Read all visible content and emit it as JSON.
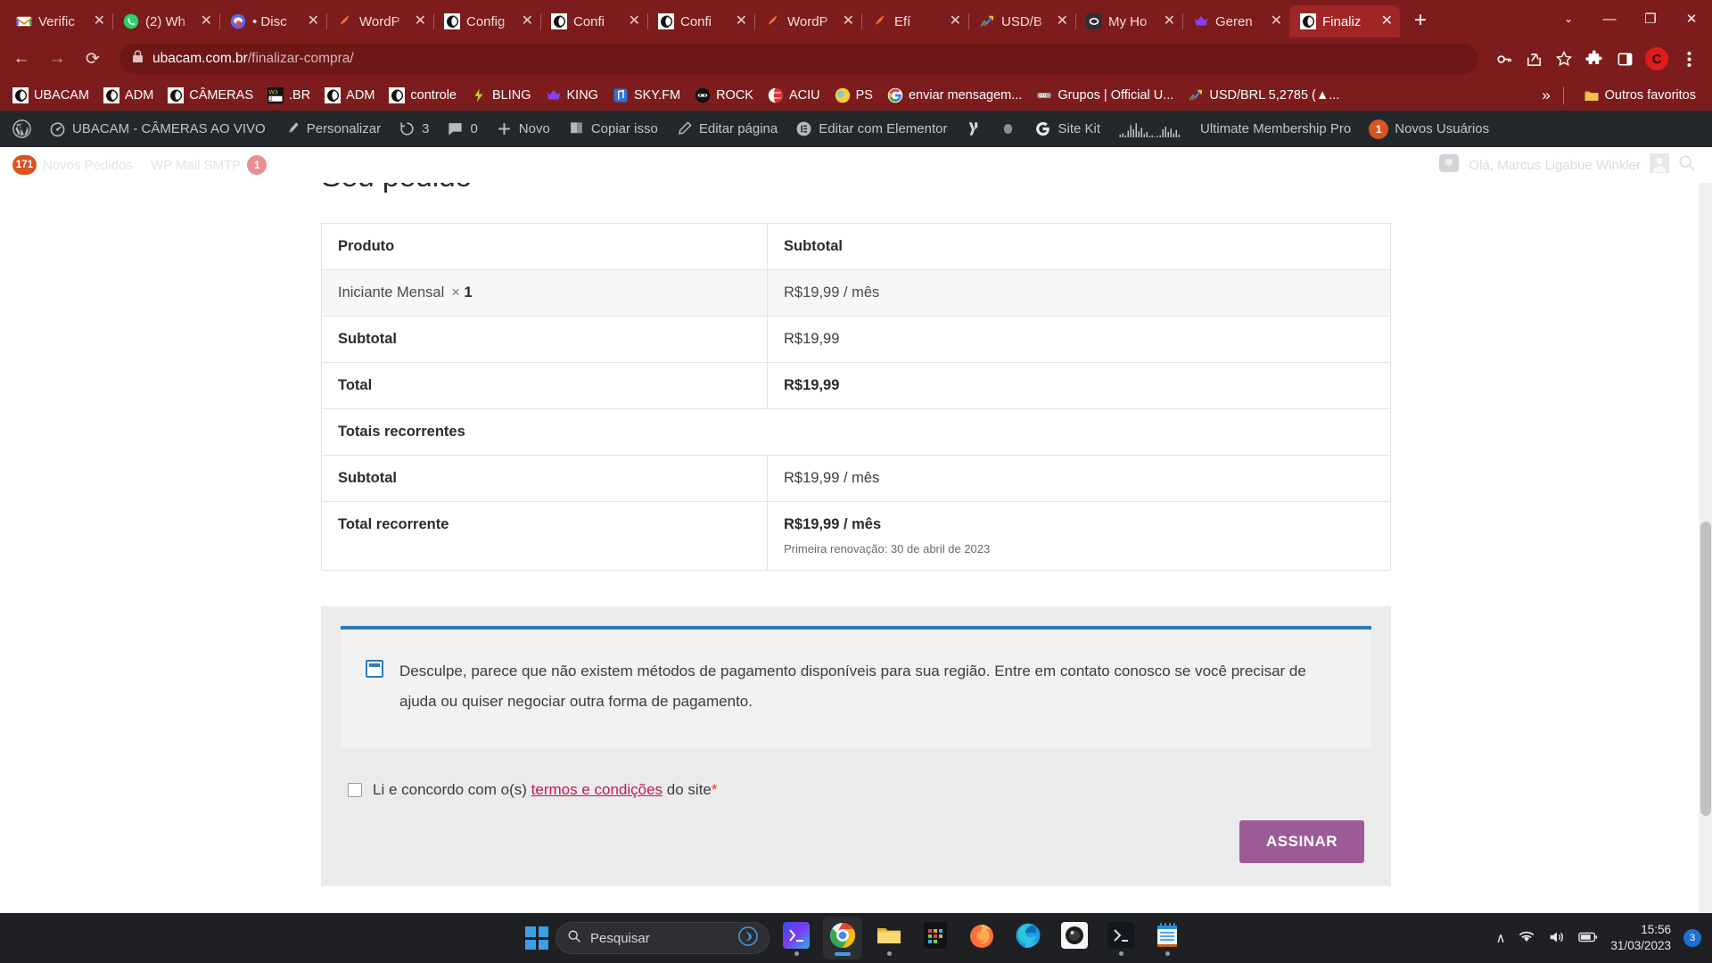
{
  "browser": {
    "tabs": [
      {
        "title": "Verific",
        "icon": "gmail-icon",
        "active": false
      },
      {
        "title": "(2) Wh",
        "icon": "whatsapp-icon",
        "active": false
      },
      {
        "title": "• Disc",
        "icon": "discord-icon",
        "active": false
      },
      {
        "title": "WordP",
        "icon": "elementor-icon",
        "active": false
      },
      {
        "title": "Config",
        "icon": "ubacam-icon",
        "active": false
      },
      {
        "title": "Confi",
        "icon": "ubacam-icon",
        "active": false
      },
      {
        "title": "Confi",
        "icon": "ubacam-icon",
        "active": false
      },
      {
        "title": "WordP",
        "icon": "elementor-icon",
        "active": false
      },
      {
        "title": "Efí",
        "icon": "elementor-icon",
        "active": false
      },
      {
        "title": "USD/B",
        "icon": "google-finance-icon",
        "active": false
      },
      {
        "title": "My Ho",
        "icon": "hostinger-icon",
        "active": false
      },
      {
        "title": "Geren",
        "icon": "crown-icon",
        "active": false
      },
      {
        "title": "Finaliz",
        "icon": "ubacam-icon",
        "active": true
      }
    ],
    "new_tab_label": "+",
    "close_label": "✕",
    "window_controls": {
      "list": "⌄",
      "minimize": "—",
      "maximize": "❐",
      "close": "✕"
    },
    "nav": {
      "back": "←",
      "forward": "→",
      "reload": "⟳"
    },
    "url": {
      "lock": "lock-icon",
      "domain": "ubacam.com.br",
      "path": "/finalizar-compra/"
    },
    "toolbar_icons": [
      "key-icon",
      "share-icon",
      "bookmark-star-icon",
      "extensions-puzzle-icon",
      "side-panel-icon",
      "profile-avatar-icon",
      "chrome-menu-icon"
    ],
    "profile_initial": "C"
  },
  "bookmarks": {
    "items": [
      {
        "label": "UBACAM",
        "icon": "ubacam-icon"
      },
      {
        "label": "ADM",
        "icon": "ubacam-icon"
      },
      {
        "label": "CÂMERAS",
        "icon": "ubacam-icon"
      },
      {
        "label": ".BR",
        "icon": "registrobr-icon"
      },
      {
        "label": "ADM",
        "icon": "ubacam-icon"
      },
      {
        "label": "controle",
        "icon": "ubacam-icon"
      },
      {
        "label": "BLING",
        "icon": "bling-icon"
      },
      {
        "label": "KING",
        "icon": "crown-icon"
      },
      {
        "label": "SKY.FM",
        "icon": "radio-icon"
      },
      {
        "label": "ROCK",
        "icon": "rock-icon"
      },
      {
        "label": "ACIU",
        "icon": "globe-icon"
      },
      {
        "label": "PS",
        "icon": "ps-icon"
      },
      {
        "label": "enviar mensagem...",
        "icon": "google-icon"
      },
      {
        "label": "Grupos | Official U...",
        "icon": "google-docs-icon"
      },
      {
        "label": "USD/BRL 5,2785 (▲...",
        "icon": "google-finance-icon"
      }
    ],
    "overflow_label": "»",
    "other_label": "Outros favoritos",
    "other_icon": "folder-icon"
  },
  "wp_admin_bar": {
    "items": [
      {
        "label": "",
        "icon": "wordpress-logo-icon"
      },
      {
        "label": "UBACAM - CÂMERAS AO VIVO",
        "icon": "dashboard-icon"
      },
      {
        "label": "Personalizar",
        "icon": "brush-icon"
      },
      {
        "label": "3",
        "icon": "updates-icon"
      },
      {
        "label": "0",
        "icon": "comments-icon"
      },
      {
        "label": "Novo",
        "icon": "plus-icon"
      },
      {
        "label": "Copiar isso",
        "icon": "copy-icon"
      },
      {
        "label": "Editar página",
        "icon": "pencil-icon"
      },
      {
        "label": "Editar com Elementor",
        "icon": "elementor-e-icon"
      },
      {
        "label": "",
        "icon": "yoast-icon"
      },
      {
        "label": "",
        "icon": "gray-dot-icon"
      },
      {
        "label": "Site Kit",
        "icon": "google-g-icon"
      },
      {
        "label": "",
        "icon": "analytics-sparkline-icon"
      },
      {
        "label": "Ultimate Membership Pro",
        "icon": ""
      },
      {
        "label": "Novos Usuários",
        "icon": "",
        "badge": "1"
      }
    ],
    "second_row": {
      "orders_badge": "171",
      "orders_label": "Novos Pedidos",
      "smtp_label": "WP Mail SMTP",
      "smtp_badge": "1",
      "greeting": "Olá, Marcus Ligabue Winkler",
      "comment_icon": "comment-bubble-icon",
      "avatar_icon": "user-avatar-icon",
      "search_icon": "search-icon"
    }
  },
  "order": {
    "title": "Seu pedido",
    "headers": [
      "Produto",
      "Subtotal"
    ],
    "rows": [
      {
        "kind": "product",
        "label": "Iniciante Mensal",
        "times": "×",
        "qty": "1",
        "value": "R$19,99 / mês"
      },
      {
        "kind": "normal",
        "label": "Subtotal",
        "value": "R$19,99"
      },
      {
        "kind": "strong",
        "label": "Total",
        "value": "R$19,99"
      },
      {
        "kind": "section",
        "label": "Totais recorrentes",
        "value": ""
      },
      {
        "kind": "normal",
        "label": "Subtotal",
        "value": "R$19,99 / mês"
      },
      {
        "kind": "strong",
        "label": "Total recorrente",
        "value": "R$19,99 / mês",
        "note": "Primeira renovação: 30 de abril de 2023"
      }
    ]
  },
  "payment": {
    "notice": "Desculpe, parece que não existem métodos de pagamento disponíveis para sua região. Entre em contato conosco se você precisar de ajuda ou quiser negociar outra forma de pagamento.",
    "accent_color": "#2b7bb9",
    "icon": "info-note-icon"
  },
  "terms": {
    "prefix": "Li e concordo com o(s)",
    "link": "termos e condições",
    "suffix": "do site",
    "required_mark": "*",
    "checked": false
  },
  "submit": {
    "label": "ASSINAR",
    "color": "#9c5b96"
  },
  "taskbar": {
    "search_placeholder": "Pesquisar",
    "start_icon": "windows-start-icon",
    "search_icon": "search-icon",
    "copilot_icon": "copilot-icon",
    "apps": [
      {
        "name": "windows-terminal-gradient-icon",
        "active": false
      },
      {
        "name": "google-chrome-icon",
        "active": true
      },
      {
        "name": "file-explorer-icon",
        "active": false
      },
      {
        "name": "store-icon",
        "active": false
      },
      {
        "name": "firefox-icon",
        "active": false
      },
      {
        "name": "microsoft-edge-icon",
        "active": false
      },
      {
        "name": "camera-viewer-icon",
        "active": false
      },
      {
        "name": "powershell-icon",
        "active": false
      },
      {
        "name": "notepad-icon",
        "active": false
      }
    ],
    "tray": {
      "chevron": "∧",
      "wifi": "wifi-icon",
      "volume": "volume-icon",
      "battery": "battery-icon",
      "time": "15:56",
      "date": "31/03/2023",
      "notification_count": "3"
    }
  }
}
